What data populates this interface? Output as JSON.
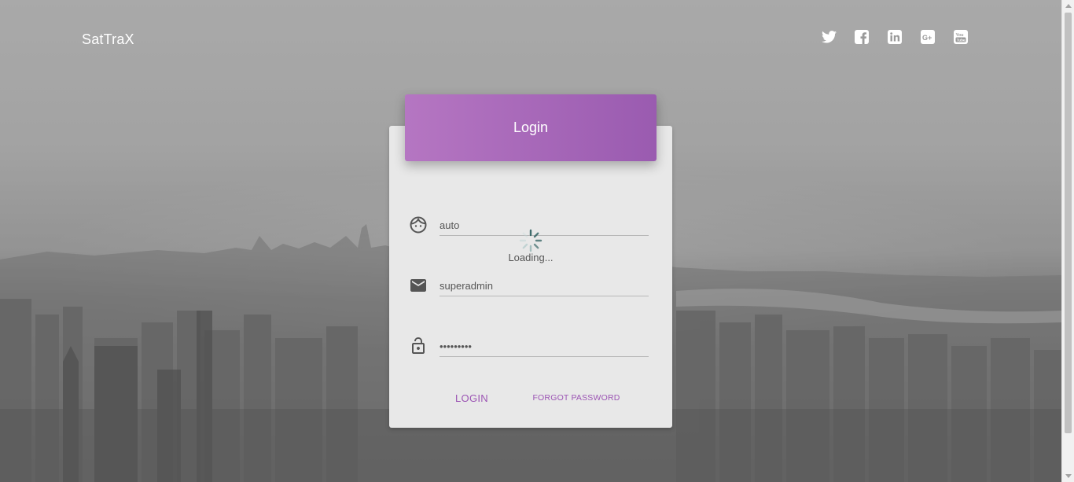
{
  "brand": {
    "name": "SatTraX"
  },
  "social": [
    {
      "icon": "twitter-icon"
    },
    {
      "icon": "facebook-icon"
    },
    {
      "icon": "linkedin-icon"
    },
    {
      "icon": "google-plus-icon"
    },
    {
      "icon": "youtube-icon"
    }
  ],
  "login_card": {
    "title": "Login",
    "fields": {
      "company": {
        "icon": "face-icon",
        "value": "auto"
      },
      "username": {
        "icon": "email-icon",
        "value": "superadmin"
      },
      "password": {
        "icon": "lock-icon",
        "value": "•••••••••"
      }
    },
    "loading_text": "Loading...",
    "login_label": "LOGIN",
    "forgot_label": "FORGOT PASSWORD"
  },
  "colors": {
    "accent": "#9c55b4",
    "header_gradient_start": "#b576c2",
    "header_gradient_end": "#9a5bb0"
  }
}
